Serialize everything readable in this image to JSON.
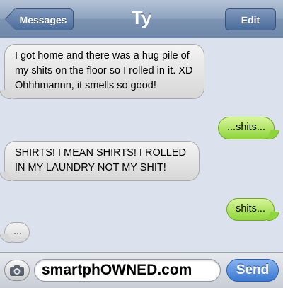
{
  "header": {
    "back_label": "Messages",
    "title": "Ty",
    "edit_label": "Edit"
  },
  "messages": [
    {
      "side": "received",
      "text": "I got home and there was a hug pile of my shits on the floor so I rolled in it. XD Ohhhmannn, it smells so good!"
    },
    {
      "side": "sent",
      "text": "...shits..."
    },
    {
      "side": "received",
      "text": "SHIRTS! I MEAN SHIRTS! I ROLLED IN MY LAUNDRY NOT MY SHIT!"
    },
    {
      "side": "sent",
      "text": "shits..."
    },
    {
      "side": "received",
      "text": "..."
    }
  ],
  "composer": {
    "value": "smartphOWNED.com",
    "send_label": "Send"
  },
  "colors": {
    "sent_bubble": "#8ed53a",
    "received_bubble": "#e6e6e6",
    "send_button": "#3a78d3",
    "navbar": "#7d94b3"
  },
  "icons": {
    "back": "chevron-left-icon",
    "camera": "camera-icon"
  }
}
